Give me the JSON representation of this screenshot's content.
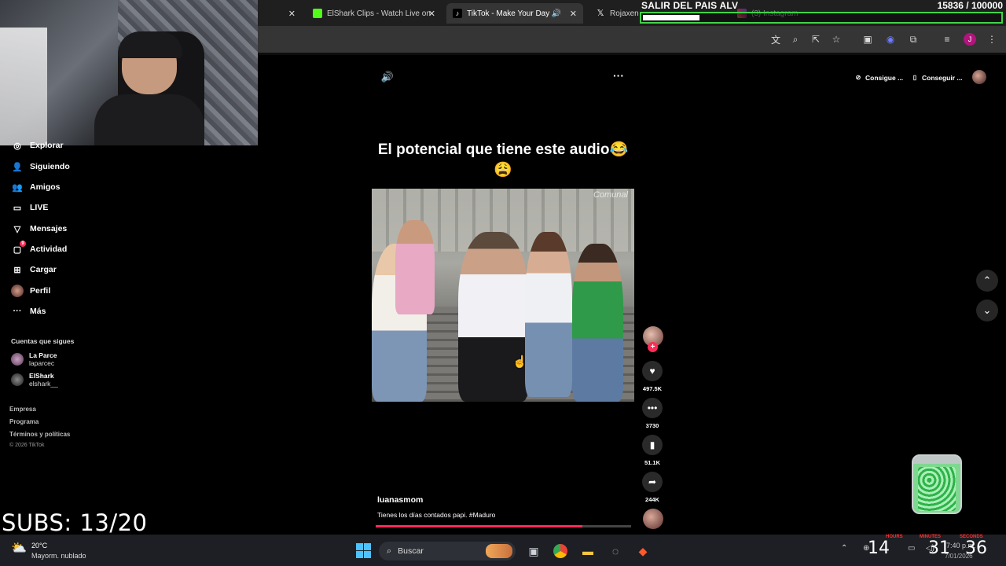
{
  "browser": {
    "tabs": [
      {
        "title": "",
        "icon": "tab-icon"
      },
      {
        "title": "ElShark Clips - Watch Live on",
        "icon": "kick-icon"
      },
      {
        "title": "TikTok - Make Your Day",
        "icon": "tiktok-icon",
        "active": true
      },
      {
        "title": "Rojaxen",
        "icon": "x-icon"
      },
      {
        "title": "(3) Instagram",
        "icon": "instagram-icon"
      }
    ]
  },
  "stream": {
    "goal_title": "SALIR DEL PAIS ALV",
    "goal_count": "15836  / 100000",
    "goal_progress": 0.158,
    "subs": "SUBS: 13/20",
    "countdown": {
      "hours": "14",
      "minutes": "31",
      "seconds": "36",
      "hours_label": "HOURS",
      "minutes_label": "MINUTES",
      "seconds_label": "SECONDS"
    }
  },
  "sidebar": {
    "items": [
      {
        "label": "Explorar",
        "icon": "compass-icon"
      },
      {
        "label": "Siguiendo",
        "icon": "following-icon"
      },
      {
        "label": "Amigos",
        "icon": "friends-icon"
      },
      {
        "label": "LIVE",
        "icon": "live-icon"
      },
      {
        "label": "Mensajes",
        "icon": "messages-icon"
      },
      {
        "label": "Actividad",
        "icon": "activity-icon"
      },
      {
        "label": "Cargar",
        "icon": "upload-icon"
      },
      {
        "label": "Perfil",
        "icon": "profile-avatar"
      },
      {
        "label": "Más",
        "icon": "more-icon"
      }
    ],
    "activity_badge": "9",
    "following_heading": "Cuentas que sigues",
    "following": [
      {
        "name": "La Parce",
        "handle": "laparcec"
      },
      {
        "name": "ElShark",
        "handle": "elshark__"
      }
    ],
    "footer_links": [
      "Empresa",
      "Programa",
      "Términos y políticas"
    ],
    "copyright": "© 2026 TikTok"
  },
  "header": {
    "get_coins": "Consigue ...",
    "get_app": "Conseguir ..."
  },
  "video": {
    "overlay_title": "El potencial que tiene este audio😂😩",
    "watermark": "Comunal",
    "author": "luanasmom",
    "description": "Tienes los días contados papi. #Maduro",
    "progress": 0.81,
    "likes": "497.5K",
    "comments": "3730",
    "saves": "51.1K",
    "shares": "244K"
  },
  "taskbar": {
    "temperature": "20°C",
    "weather": "Mayorm. nublado",
    "search_placeholder": "Buscar",
    "time": "7:40 p.m.",
    "date": "7/01/2026"
  }
}
